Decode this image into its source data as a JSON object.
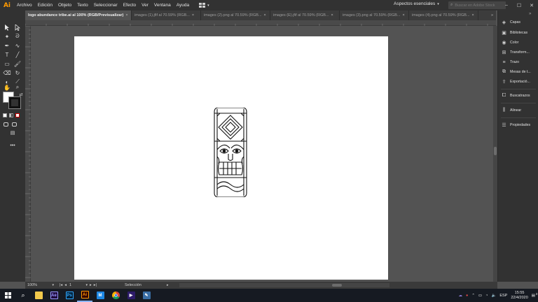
{
  "app": {
    "logo": "Ai"
  },
  "menu": [
    "Archivo",
    "Edición",
    "Objeto",
    "Texto",
    "Seleccionar",
    "Efecto",
    "Ver",
    "Ventana",
    "Ayuda"
  ],
  "workspace": {
    "label": "Aspectos esenciales"
  },
  "search": {
    "placeholder": "Buscar en Adobe Stock"
  },
  "tabs": [
    "logo abundance tribe.ai al 100% (RGB/Previsualizar)",
    "images (1).jfif al 70.59% (RGB...",
    "images (2).png al 70.59% (RGB...",
    "images (E).jfif al 70.59% (RGB...",
    "images (3).png al 70.59% (RGB...",
    "images (4).png al 70.59% (RGB..."
  ],
  "panels": [
    "Capas",
    "Bibliotecas",
    "Color",
    "Transform...",
    "Trazo",
    "Mesas de t...",
    "Exportació...",
    "Buscatrazos",
    "Alinear",
    "Propiedades"
  ],
  "status": {
    "zoom": "100%",
    "page": "1",
    "tool": "Selección"
  },
  "taskbar": {
    "language": "ESP",
    "time": "15:55",
    "date": "22/4/2020",
    "notifications": "3"
  },
  "colors": {
    "ai_orange": "#ff9a00",
    "ae_purple": "#9999ff",
    "ps_blue": "#31a8ff",
    "taskbar": "#161a22"
  }
}
